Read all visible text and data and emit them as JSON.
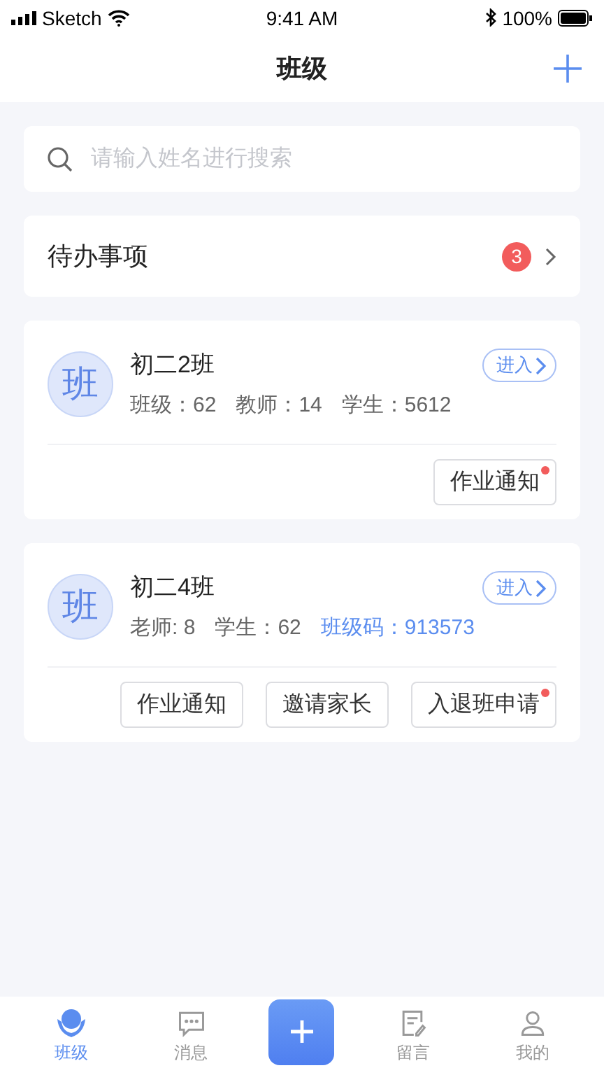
{
  "status_bar": {
    "carrier": "Sketch",
    "time": "9:41 AM",
    "battery": "100%"
  },
  "header": {
    "title": "班级"
  },
  "search": {
    "placeholder": "请输入姓名进行搜索"
  },
  "todo": {
    "label": "待办事项",
    "count": "3"
  },
  "classes": [
    {
      "avatar_text": "班",
      "name": "初二2班",
      "enter": "进入",
      "stats": [
        {
          "kind": "plain",
          "text": "班级：62"
        },
        {
          "kind": "plain",
          "text": "教师：14"
        },
        {
          "kind": "plain",
          "text": "学生：5612"
        }
      ],
      "actions": [
        {
          "label": "作业通知",
          "dot": true
        }
      ]
    },
    {
      "avatar_text": "班",
      "name": "初二4班",
      "enter": "进入",
      "stats": [
        {
          "kind": "plain",
          "text": "老师: 8"
        },
        {
          "kind": "plain",
          "text": "学生：62"
        },
        {
          "kind": "code",
          "text": "班级码：913573"
        }
      ],
      "actions": [
        {
          "label": "作业通知",
          "dot": false
        },
        {
          "label": "邀请家长",
          "dot": false
        },
        {
          "label": "入退班申请",
          "dot": true
        }
      ]
    }
  ],
  "tab_bar": [
    {
      "kind": "class",
      "label": "班级",
      "selected": true
    },
    {
      "kind": "message",
      "label": "消息",
      "selected": false
    },
    {
      "kind": "add",
      "selected": false
    },
    {
      "kind": "note",
      "label": "留言",
      "selected": false
    },
    {
      "kind": "profile",
      "label": "我的",
      "selected": false
    }
  ]
}
